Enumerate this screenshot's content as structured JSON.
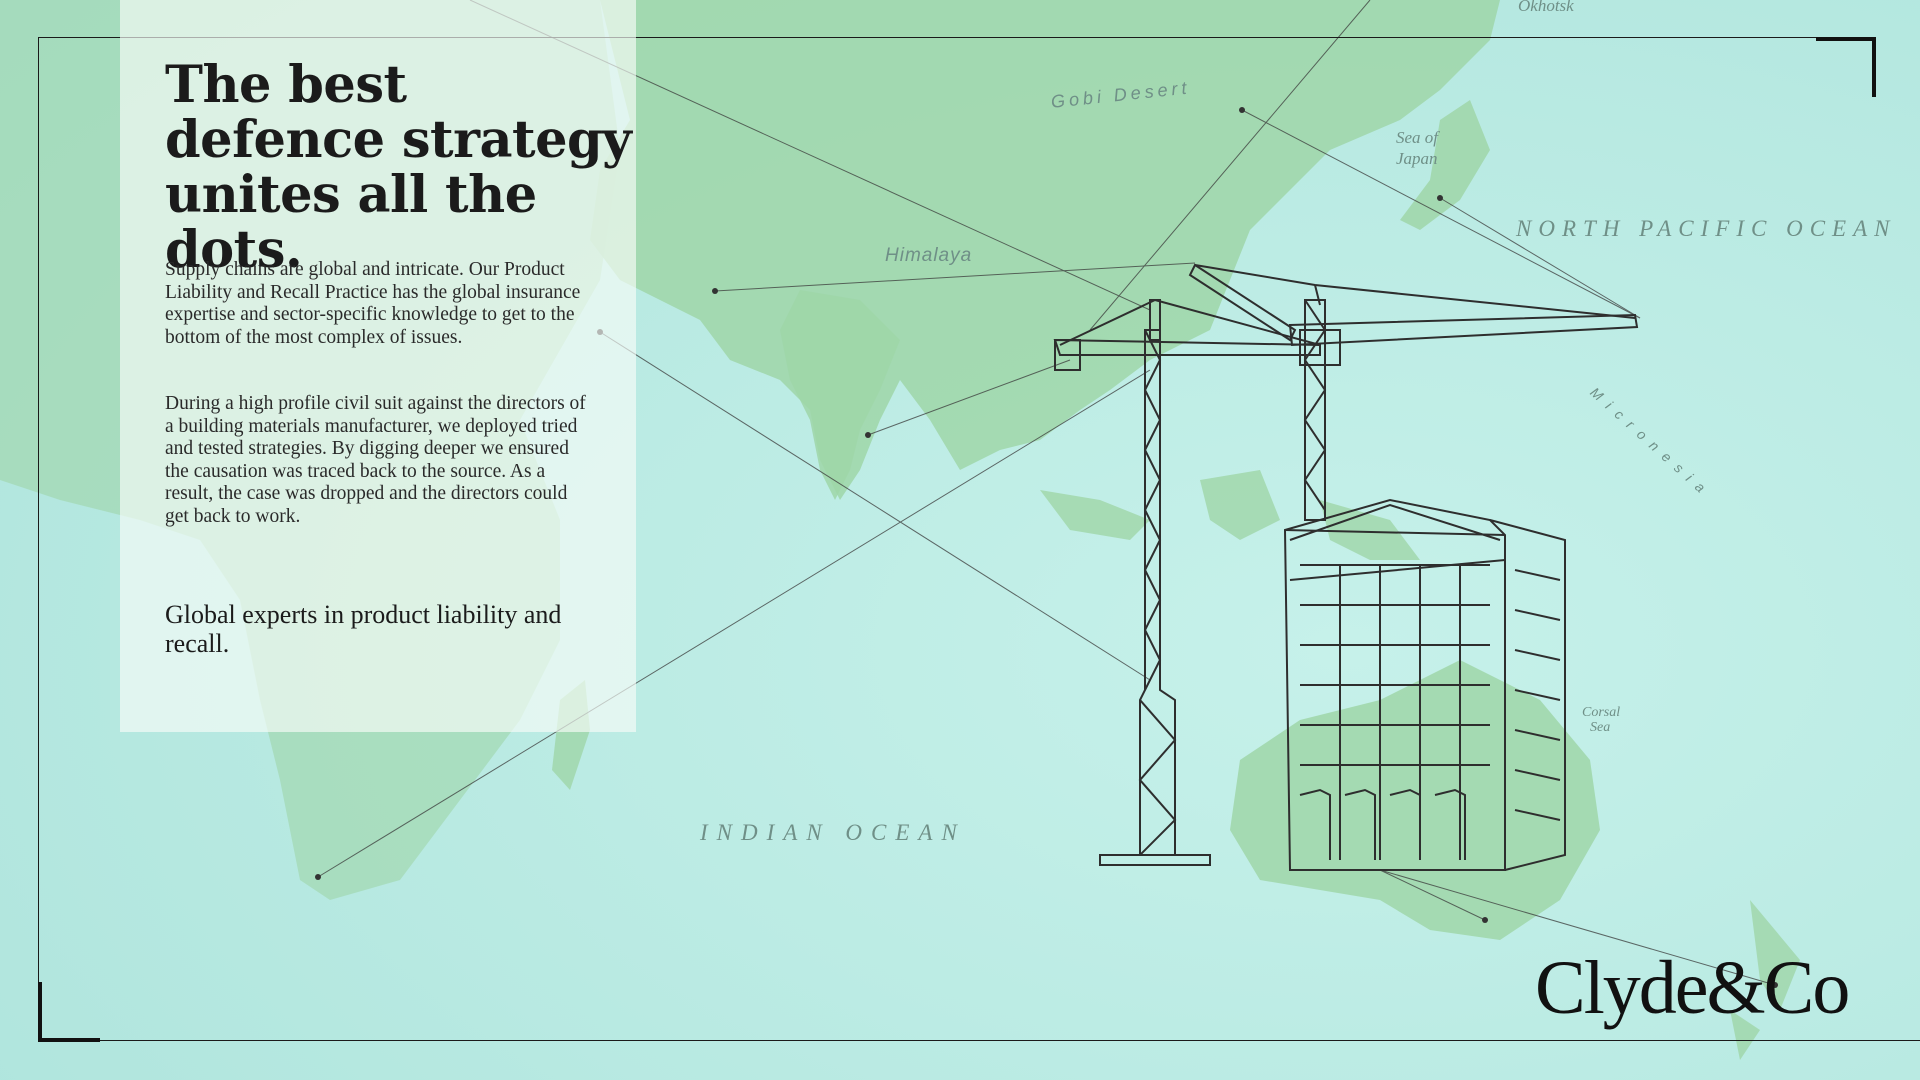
{
  "headline": "The best defence strategy unites all the dots.",
  "paragraphs": [
    "Supply chains are global and intricate. Our Product Liability and Recall Practice has the global insurance expertise and sector-specific knowledge to get to the bottom of the most complex of issues.",
    "During a high profile civil suit against the directors of a building materials manufacturer, we deployed tried and tested strategies. By digging deeper we ensured the causation was traced back to the source. As a result, the case was dropped and the directors could get back to work."
  ],
  "tagline": "Global experts in product liability and recall.",
  "map_labels": {
    "okhotsk": "Okhotsk",
    "gobi": "Gobi Desert",
    "sea_of_japan_1": "Sea of",
    "sea_of_japan_2": "Japan",
    "north_pacific": "NORTH PACIFIC OCEAN",
    "himalaya": "Himalaya",
    "micronesia": "Micronesia",
    "coral_1": "Corsal",
    "coral_2": "Sea",
    "indian_ocean": "INDIAN OCEAN"
  },
  "logo": "Clyde&Co",
  "colors": {
    "ocean": "#bdeee6",
    "land": "#9fd6a8",
    "text": "#1b1b1b",
    "lines": "#3a3a3a"
  }
}
